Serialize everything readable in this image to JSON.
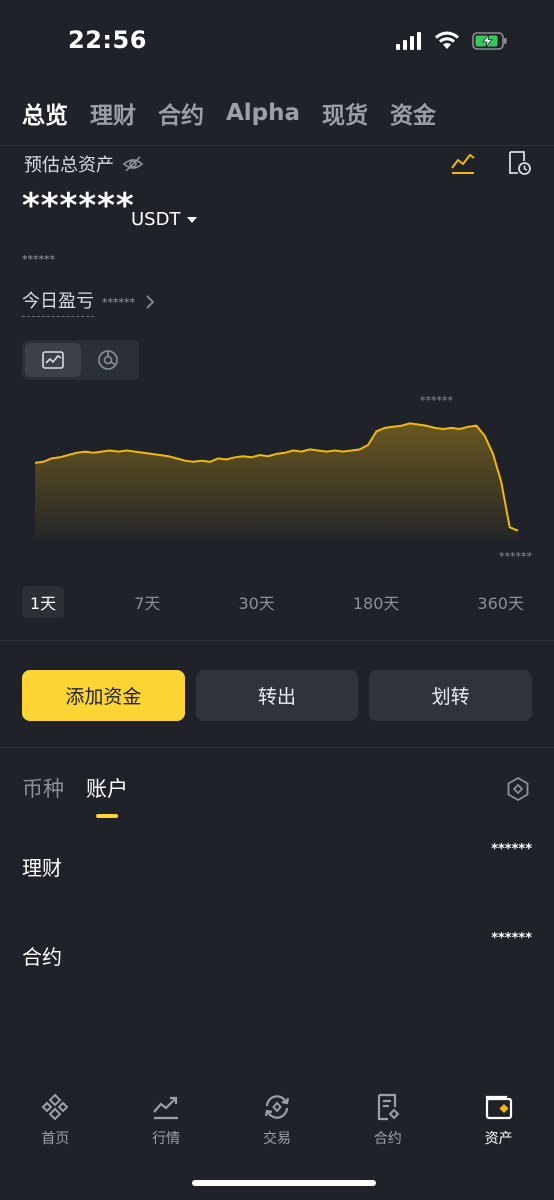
{
  "status_bar": {
    "time": "22:56",
    "icons": [
      "signal-icon",
      "wifi-icon",
      "battery-charging-icon"
    ],
    "battery_color": "#34c759"
  },
  "top_tabs": [
    {
      "label": "总览",
      "active": true
    },
    {
      "label": "理财",
      "active": false
    },
    {
      "label": "合约",
      "active": false
    },
    {
      "label": "Alpha",
      "active": false
    },
    {
      "label": "现货",
      "active": false
    },
    {
      "label": "资金",
      "active": false
    }
  ],
  "overview": {
    "estimated_label": "预估总资产",
    "balance_masked": "******",
    "currency": "USDT",
    "secondary_masked": "******",
    "pnl_label": "今日盈亏",
    "pnl_masked": "******"
  },
  "chart": {
    "peak_label": "******",
    "end_label": "******",
    "line_color": "#f0b90b",
    "relative_series": [
      0.62,
      0.63,
      0.66,
      0.67,
      0.69,
      0.71,
      0.72,
      0.71,
      0.72,
      0.73,
      0.72,
      0.73,
      0.72,
      0.71,
      0.7,
      0.69,
      0.68,
      0.66,
      0.64,
      0.63,
      0.64,
      0.63,
      0.66,
      0.65,
      0.67,
      0.68,
      0.67,
      0.69,
      0.68,
      0.7,
      0.71,
      0.73,
      0.72,
      0.74,
      0.73,
      0.72,
      0.73,
      0.72,
      0.73,
      0.74,
      0.78,
      0.9,
      0.93,
      0.94,
      0.95,
      0.97,
      0.96,
      0.95,
      0.93,
      0.92,
      0.93,
      0.92,
      0.94,
      0.95,
      0.86,
      0.7,
      0.45,
      0.05,
      0.02
    ]
  },
  "range_tabs": [
    {
      "label": "1天",
      "active": true
    },
    {
      "label": "7天",
      "active": false
    },
    {
      "label": "30天",
      "active": false
    },
    {
      "label": "180天",
      "active": false
    },
    {
      "label": "360天",
      "active": false
    }
  ],
  "actions": {
    "add_funds": "添加资金",
    "withdraw": "转出",
    "transfer": "划转",
    "primary_color": "#fcd535"
  },
  "sub_tabs": [
    {
      "label": "币种",
      "active": false
    },
    {
      "label": "账户",
      "active": true
    }
  ],
  "accounts": [
    {
      "name": "理财",
      "value": "******"
    },
    {
      "name": "合约",
      "value": "******"
    }
  ],
  "bottom_nav": [
    {
      "label": "首页",
      "icon": "binance-logo-icon",
      "active": false
    },
    {
      "label": "行情",
      "icon": "market-chart-icon",
      "active": false
    },
    {
      "label": "交易",
      "icon": "trade-exchange-icon",
      "active": false
    },
    {
      "label": "合约",
      "icon": "futures-doc-icon",
      "active": false
    },
    {
      "label": "资产",
      "icon": "wallet-icon",
      "active": true
    }
  ]
}
